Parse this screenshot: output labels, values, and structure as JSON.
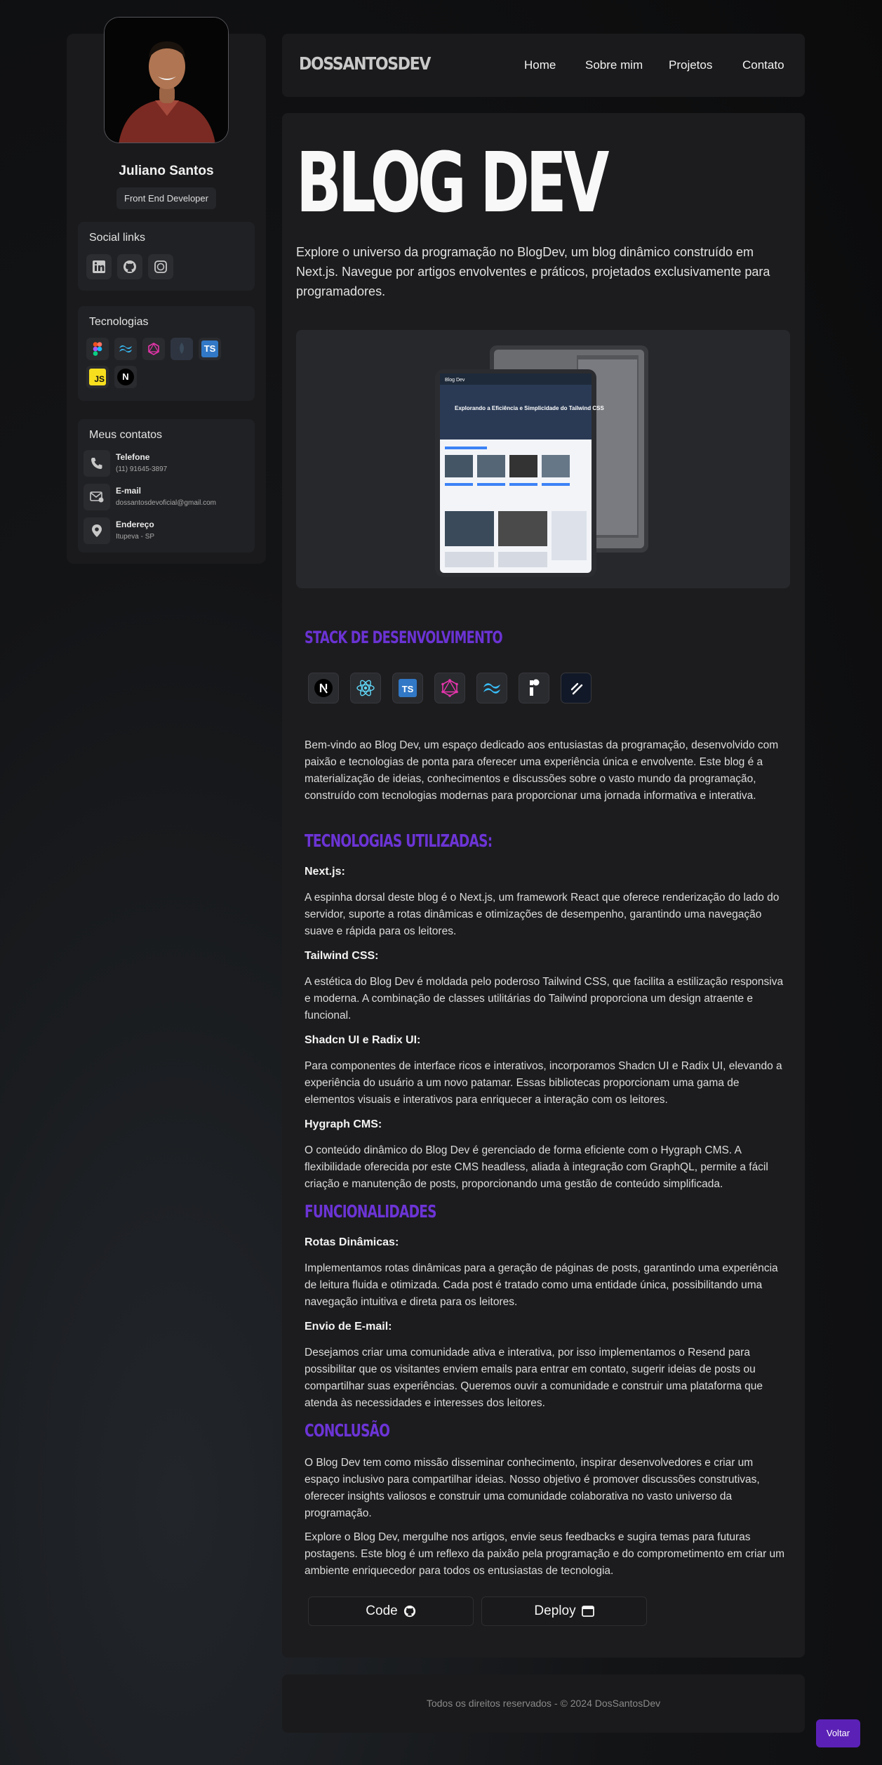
{
  "sidebar": {
    "name": "Juliano Santos",
    "role": "Front End Developer",
    "social_title": "Social links",
    "social_icons": [
      "linkedin-icon",
      "github-icon",
      "whatsapp-icon"
    ],
    "tech_title": "Tecnologias",
    "tech_icons": [
      "figma-icon",
      "tailwind-icon",
      "graphql-icon",
      "mongodb-icon",
      "typescript-icon",
      "javascript-icon",
      "nextjs-icon"
    ],
    "ts_label": "TS",
    "js_label": "JS",
    "next_label": "N",
    "contacts_title": "Meus contatos",
    "contacts": [
      {
        "label": "Telefone",
        "value": "(11) 91645-3897"
      },
      {
        "label": "E-mail",
        "value": "dossantosdevoficial@gmail.com"
      },
      {
        "label": "Endereço",
        "value": "Itupeva - SP"
      }
    ]
  },
  "navbar": {
    "logo": "DOSSANTOSDEV",
    "links": [
      "Home",
      "Sobre mim",
      "Projetos",
      "Contato"
    ]
  },
  "main": {
    "title": "BLOG DEV",
    "intro": "Explore o universo da programação no BlogDev, um blog dinâmico construído em Next.js. Navegue por artigos envolventes e práticos, projetados exclusivamente para programadores.",
    "mockup": {
      "brand": "Blog Dev",
      "headline": "Explorando a Eficiência e Simplicidade do Tailwind CSS"
    },
    "stack_title": "STACK DE DESENVOLVIMENTO",
    "stack_icons": [
      "nextjs-icon",
      "react-icon",
      "typescript-icon",
      "graphql-icon",
      "tailwind-icon",
      "radix-icon",
      "shadcn-icon"
    ],
    "welcome": "Bem-vindo ao Blog Dev, um espaço dedicado aos entusiastas da programação, desenvolvido com paixão e tecnologias de ponta para oferecer uma experiência única e envolvente. Este blog é a materialização de ideias, conhecimentos e discussões sobre o vasto mundo da programação, construído com tecnologias modernas para proporcionar uma jornada informativa e interativa.",
    "tech_title": "TECNOLOGIAS UTILIZADAS:",
    "tech_items": [
      {
        "title": "Next.js:",
        "text": "A espinha dorsal deste blog é o Next.js, um framework React que oferece renderização do lado do servidor, suporte a rotas dinâmicas e otimizações de desempenho, garantindo uma navegação suave e rápida para os leitores."
      },
      {
        "title": "Tailwind CSS:",
        "text": "A estética do Blog Dev é moldada pelo poderoso Tailwind CSS, que facilita a estilização responsiva e moderna. A combinação de classes utilitárias do Tailwind proporciona um design atraente e funcional."
      },
      {
        "title": "Shadcn UI e Radix UI:",
        "text": "Para componentes de interface ricos e interativos, incorporamos Shadcn UI e Radix UI, elevando a experiência do usuário a um novo patamar. Essas bibliotecas proporcionam uma gama de elementos visuais e interativos para enriquecer a interação com os leitores."
      },
      {
        "title": "Hygraph CMS:",
        "text": "O conteúdo dinâmico do Blog Dev é gerenciado de forma eficiente com o Hygraph CMS. A flexibilidade oferecida por este CMS headless, aliada à integração com GraphQL, permite a fácil criação e manutenção de posts, proporcionando uma gestão de conteúdo simplificada."
      }
    ],
    "func_title": "FUNCIONALIDADES",
    "func_items": [
      {
        "title": "Rotas Dinâmicas:",
        "text": "Implementamos rotas dinâmicas para a geração de páginas de posts, garantindo uma experiência de leitura fluida e otimizada. Cada post é tratado como uma entidade única, possibilitando uma navegação intuitiva e direta para os leitores."
      },
      {
        "title": "Envio de E-mail:",
        "text": "Desejamos criar uma comunidade ativa e interativa, por isso implementamos o Resend para possibilitar que os visitantes enviem emails para entrar em contato, sugerir ideias de posts ou compartilhar suas experiências. Queremos ouvir a comunidade e construir uma plataforma que atenda às necessidades e interesses dos leitores."
      }
    ],
    "conclusion_title": "CONCLUSÃO",
    "conclusion": [
      "O Blog Dev tem como missão disseminar conhecimento, inspirar desenvolvedores e criar um espaço inclusivo para compartilhar ideias. Nosso objetivo é promover discussões construtivas, oferecer insights valiosos e construir uma comunidade colaborativa no vasto universo da programação.",
      "Explore o Blog Dev, mergulhe nos artigos, envie seus feedbacks e sugira temas para futuras postagens. Este blog é um reflexo da paixão pela programação e do comprometimento em criar um ambiente enriquecedor para todos os entusiastas de tecnologia."
    ],
    "code_label": "Code",
    "deploy_label": "Deploy"
  },
  "footer": "Todos os direitos reservados - © 2024 DosSantosDev",
  "back_label": "Voltar",
  "colors": {
    "accent": "#6c34d6",
    "button": "#5b21b6"
  }
}
